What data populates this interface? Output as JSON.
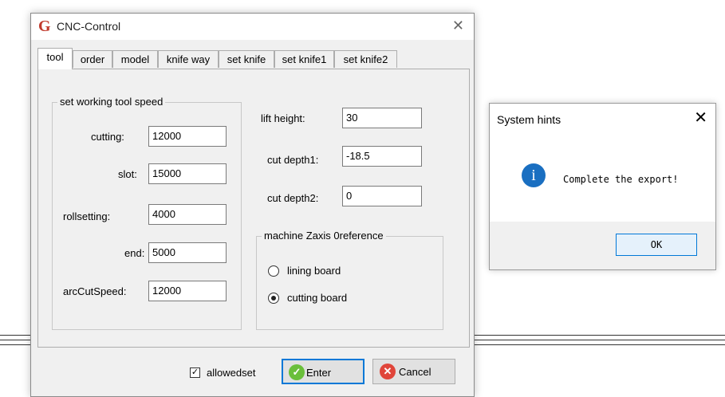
{
  "app": {
    "title": "CNC-Control",
    "icon": "G"
  },
  "tabs": [
    {
      "label": "tool"
    },
    {
      "label": "order"
    },
    {
      "label": "model"
    },
    {
      "label": "knife way"
    },
    {
      "label": "set knife"
    },
    {
      "label": "set knife1"
    },
    {
      "label": "set knife2"
    }
  ],
  "speed_group": {
    "legend": "set working tool speed",
    "cutting_label": "cutting:",
    "cutting_value": "12000",
    "slot_label": "slot:",
    "slot_value": "15000",
    "roll_label": "rollsetting:",
    "roll_value": "4000",
    "end_label": "end:",
    "end_value": "5000",
    "arc_label": "arcCutSpeed:",
    "arc_value": "12000"
  },
  "heights": {
    "lift_label": "lift height:",
    "lift_value": "30",
    "depth1_label": "cut depth1:",
    "depth1_value": "-18.5",
    "depth2_label": "cut depth2:",
    "depth2_value": "0"
  },
  "zaxis_group": {
    "legend": "machine Zaxis 0reference",
    "option1": "lining board",
    "option2": "cutting board",
    "selected": "cutting board"
  },
  "footer": {
    "allowedset_label": "allowedset",
    "allowedset_checked": true,
    "enter_label": "Enter",
    "cancel_label": "Cancel"
  },
  "hint_dialog": {
    "title": "System hints",
    "message": "Complete the export!",
    "ok_label": "OK",
    "icon": "info-icon"
  },
  "colors": {
    "accent": "#0078d7",
    "info": "#1a6fc1",
    "app_icon": "#c0392b"
  }
}
